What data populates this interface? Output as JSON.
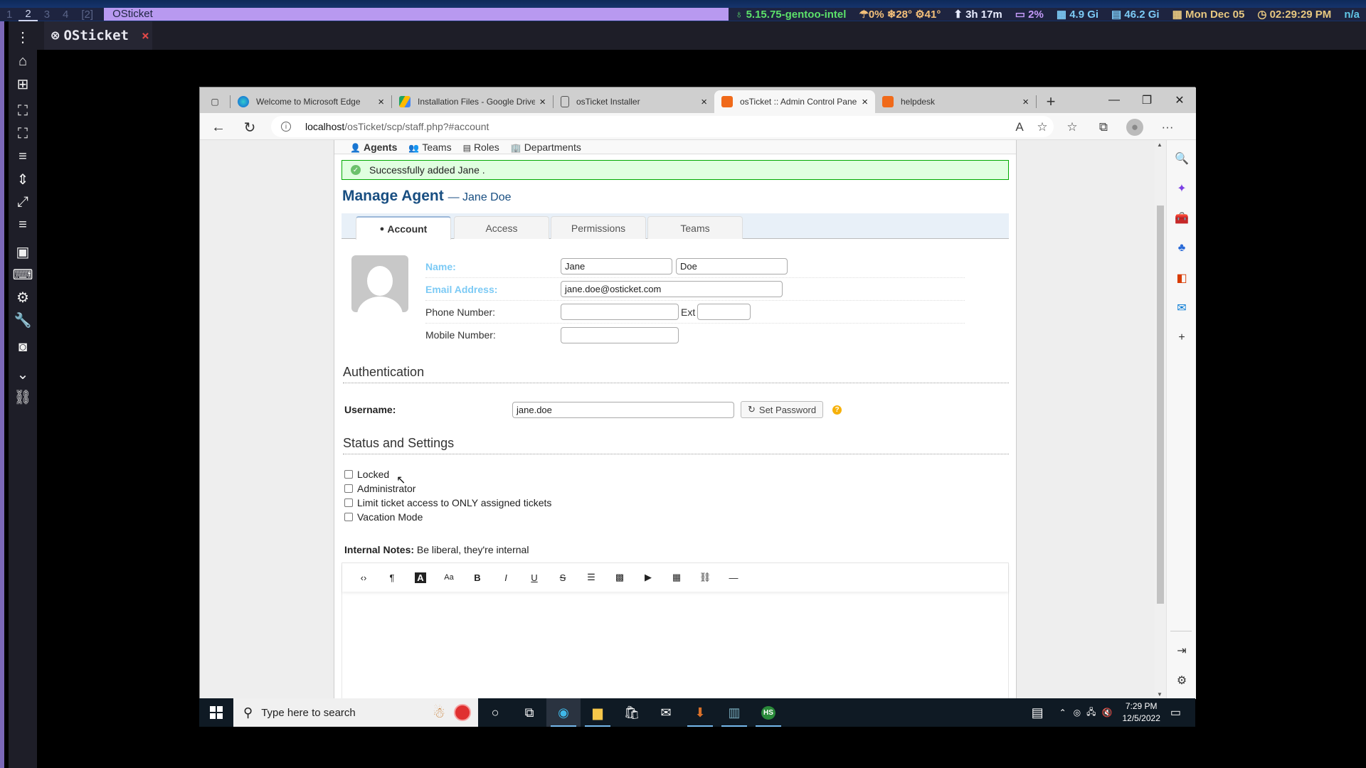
{
  "wm": {
    "workspaces": [
      "1",
      "2",
      "3",
      "4",
      "[2]"
    ],
    "active_workspace": "2",
    "window_title": "OSticket",
    "status": {
      "kernel": "5.15.75-gentoo-intel",
      "rain": "0%",
      "temp1": "28°",
      "temp2": "41°",
      "uptime": "3h 17m",
      "cpu": "2%",
      "mem": "4.9 Gi",
      "disk": "46.2 Gi",
      "date": "Mon Dec 05",
      "time": "02:29:29 PM",
      "extra": "n/a"
    }
  },
  "app": {
    "tab_title": "OSticket",
    "close_glyph": "×"
  },
  "browser": {
    "tabs": [
      {
        "title": "Welcome to Microsoft Edge",
        "active": false
      },
      {
        "title": "Installation Files - Google Drive",
        "active": false
      },
      {
        "title": "osTicket Installer",
        "active": false
      },
      {
        "title": "osTicket :: Admin Control Panel",
        "active": true
      },
      {
        "title": "helpdesk",
        "active": false
      }
    ],
    "url_host": "localhost",
    "url_path": "/osTicket/scp/staff.php?#account"
  },
  "page": {
    "subnav": [
      "Agents",
      "Teams",
      "Roles",
      "Departments"
    ],
    "notice": "Successfully added Jane .",
    "title": "Manage Agent",
    "title_sub": "— Jane Doe",
    "tabs": [
      "Account",
      "Access",
      "Permissions",
      "Teams"
    ],
    "form": {
      "name_label": "Name:",
      "first_name": "Jane",
      "last_name": "Doe",
      "email_label": "Email Address:",
      "email": "jane.doe@osticket.com",
      "phone_label": "Phone Number:",
      "phone": "",
      "ext_label": "Ext",
      "ext": "",
      "mobile_label": "Mobile Number:",
      "mobile": ""
    },
    "auth": {
      "heading": "Authentication",
      "username_label": "Username:",
      "username": "jane.doe",
      "set_password": "Set Password"
    },
    "status": {
      "heading": "Status and Settings",
      "options": [
        {
          "label": "Locked",
          "checked": false
        },
        {
          "label": "Administrator",
          "checked": false
        },
        {
          "label": "Limit ticket access to ONLY assigned tickets",
          "checked": false
        },
        {
          "label": "Vacation Mode",
          "checked": false
        }
      ]
    },
    "notes": {
      "label": "Internal Notes:",
      "hint": "Be liberal, they're internal",
      "toolbar": [
        "code-view",
        "paragraph",
        "font-color",
        "font-size",
        "bold",
        "italic",
        "underline",
        "strikethrough",
        "list",
        "image",
        "video",
        "table",
        "link",
        "horizontal-rule"
      ]
    }
  },
  "taskbar": {
    "search_placeholder": "Type here to search",
    "time": "7:29 PM",
    "date": "12/5/2022"
  }
}
